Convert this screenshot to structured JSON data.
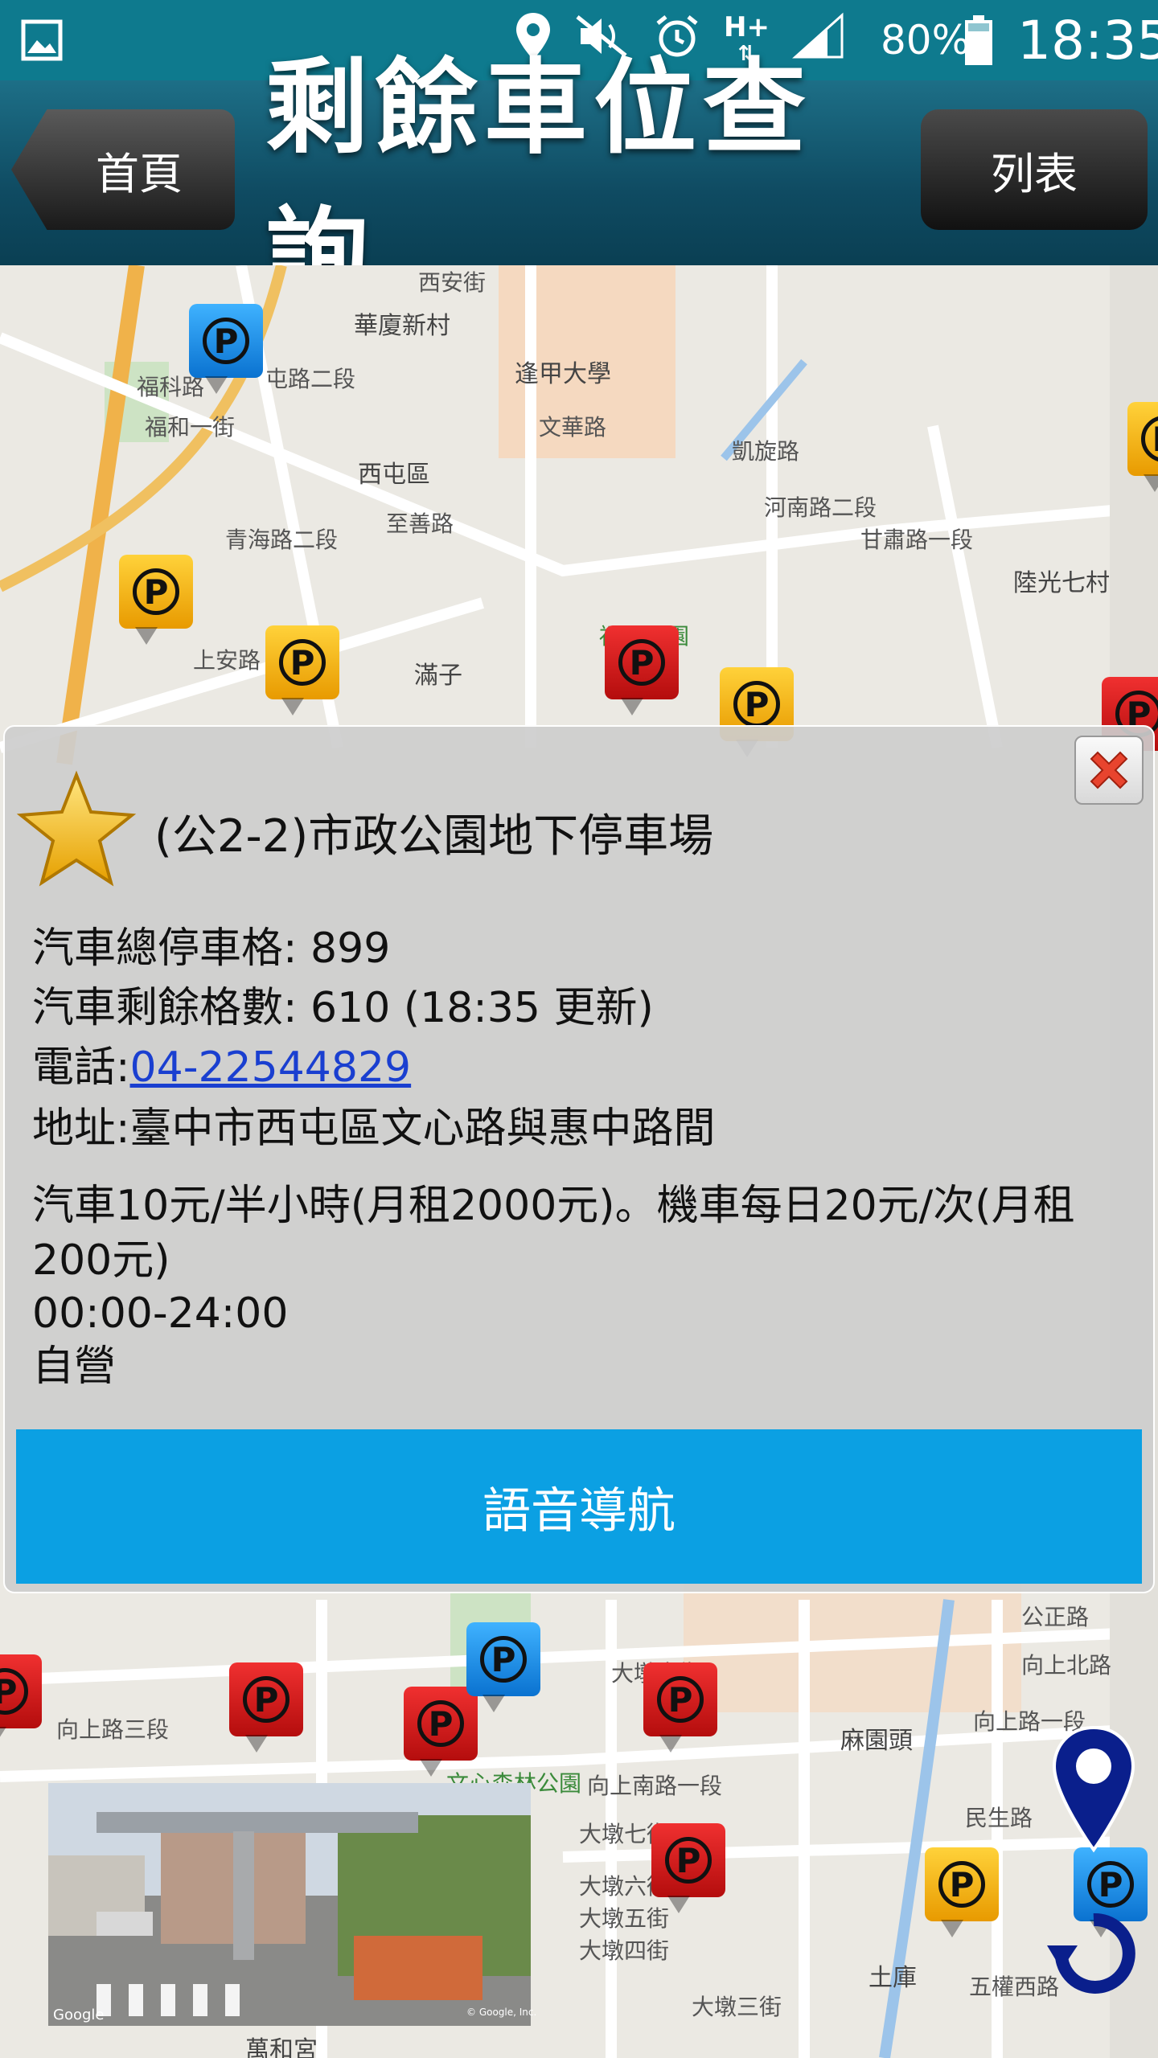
{
  "status_bar": {
    "battery_percent": "80%",
    "time": "18:35",
    "icons": [
      "gallery-icon",
      "location-icon",
      "mute-icon",
      "alarm-icon",
      "network-hplus-icon",
      "signal-icon",
      "battery-icon"
    ]
  },
  "header": {
    "home_label": "首頁",
    "title": "剩餘車位查詢",
    "list_label": "列表"
  },
  "map": {
    "labels": [
      {
        "text": "西安街"
      },
      {
        "text": "華廈新村"
      },
      {
        "text": "逢甲大學"
      },
      {
        "text": "文華路"
      },
      {
        "text": "屯路二段"
      },
      {
        "text": "福科路"
      },
      {
        "text": "福和一街"
      },
      {
        "text": "西屯區"
      },
      {
        "text": "至善路"
      },
      {
        "text": "青海路二段"
      },
      {
        "text": "凱旋路"
      },
      {
        "text": "河南路二段"
      },
      {
        "text": "甘肅路一段"
      },
      {
        "text": "陸光七村"
      },
      {
        "text": "滿子"
      },
      {
        "text": "福星公園"
      },
      {
        "text": "上安路"
      },
      {
        "text": "麻園頭"
      },
      {
        "text": "大墩十街"
      },
      {
        "text": "向上北路"
      },
      {
        "text": "向上路一段"
      },
      {
        "text": "向上路三段"
      },
      {
        "text": "文心森林公園"
      },
      {
        "text": "向上南路一段"
      },
      {
        "text": "大墩七街"
      },
      {
        "text": "大墩六街"
      },
      {
        "text": "大墩五街"
      },
      {
        "text": "大墩四街"
      },
      {
        "text": "大墩三街"
      },
      {
        "text": "民生路"
      },
      {
        "text": "五權西路"
      },
      {
        "text": "土庫"
      },
      {
        "text": "萬和宮"
      },
      {
        "text": "公正路"
      }
    ]
  },
  "popup": {
    "lot_name": "(公2-2)市政公園地下停車場",
    "total_spaces": "汽車總停車格: 899",
    "remaining_spaces": "汽車剩餘格數: 610 (18:35 更新)",
    "phone_prefix": "電話:",
    "phone": "04-22544829",
    "address": "地址:臺中市西屯區文心路與惠中路間",
    "fee_line1": "汽車10元/半小時(月租2000元)。機車每日20元/次(月租",
    "fee_line2": "200元)",
    "hours": "00:00-24:00",
    "operator": "自營",
    "nav_button": "語音導航"
  },
  "streetview": {
    "watermark": "Google",
    "copyright": "© Google, Inc."
  },
  "colors": {
    "status_bar": "#0e7a8e",
    "header": "#0f4b62",
    "nav_button": "#0ba0e3",
    "pin_red": "#e02020",
    "pin_yellow": "#f5b400",
    "pin_blue": "#1e90ff"
  }
}
